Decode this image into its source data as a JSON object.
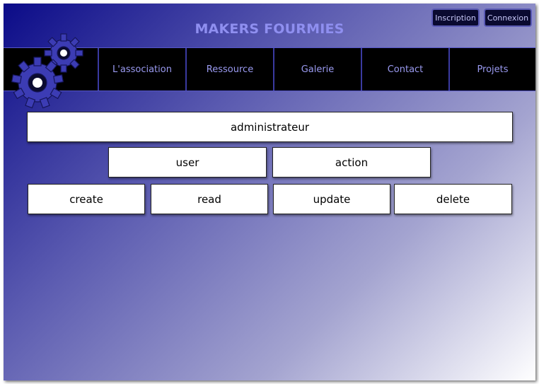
{
  "site": {
    "title": "MAKERS FOURMIES"
  },
  "auth": {
    "register_label": "Inscription",
    "login_label": "Connexion"
  },
  "nav": {
    "items": [
      {
        "label": "L'association"
      },
      {
        "label": "Ressource"
      },
      {
        "label": "Galerie"
      },
      {
        "label": "Contact"
      },
      {
        "label": "Projets"
      }
    ]
  },
  "logo": {
    "icon": "gears-icon",
    "color": "#3c3cb4"
  },
  "diagram": {
    "root": {
      "label": "administrateur"
    },
    "level2": [
      {
        "label": "user"
      },
      {
        "label": "action"
      }
    ],
    "level3": [
      {
        "label": "create"
      },
      {
        "label": "read"
      },
      {
        "label": "update"
      },
      {
        "label": "delete"
      }
    ]
  },
  "colors": {
    "accent": "#8f8ff0",
    "navbar": "#000000",
    "nav_text": "#9a9af0",
    "gradient_start": "#0b0b88",
    "gradient_end": "#ffffff"
  }
}
